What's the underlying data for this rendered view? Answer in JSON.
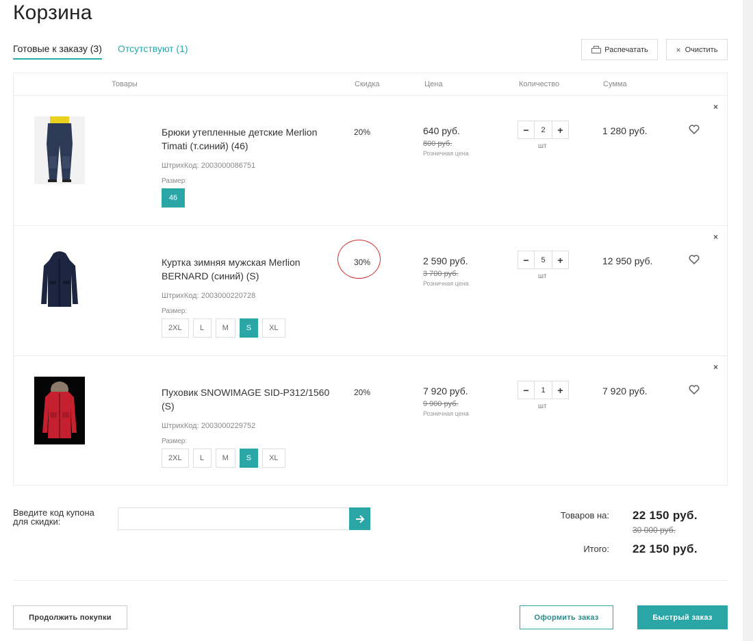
{
  "page": {
    "title": "Корзина"
  },
  "tabs": [
    {
      "label": "Готовые к заказу (3)",
      "active": true
    },
    {
      "label": "Отсутствуют (1)",
      "active": false
    }
  ],
  "toolbar": {
    "print_label": "Распечатать",
    "clear_label": "Очистить"
  },
  "table": {
    "headers": {
      "goods": "Товары",
      "discount": "Скидка",
      "price": "Цена",
      "quantity": "Количество",
      "sum": "Сумма"
    },
    "items": [
      {
        "name": "Брюки утепленные детские Merlion Timati (т.синий) (46)",
        "barcode": "ШтрихКод: 2003000086751",
        "size_label": "Размер:",
        "sizes": [
          {
            "label": "46",
            "selected": true
          }
        ],
        "discount": "20%",
        "price": "640 руб.",
        "old_price": "800 руб.",
        "price_type": "Розничная цена",
        "quantity": "2",
        "unit": "шт",
        "sum": "1 280 руб."
      },
      {
        "name": "Куртка зимняя мужская Merlion BERNARD (синий) (S)",
        "barcode": "ШтрихКод: 2003000220728",
        "size_label": "Размер:",
        "sizes": [
          {
            "label": "2XL",
            "selected": false
          },
          {
            "label": "L",
            "selected": false
          },
          {
            "label": "M",
            "selected": false
          },
          {
            "label": "S",
            "selected": true
          },
          {
            "label": "XL",
            "selected": false
          }
        ],
        "discount": "30%",
        "price": "2 590 руб.",
        "old_price": "3 700 руб.",
        "price_type": "Розничная цена",
        "quantity": "5",
        "unit": "шт",
        "sum": "12 950 руб."
      },
      {
        "name": "Пуховик SNOWIMAGE SID-P312/1560 (S)",
        "barcode": "ШтрихКод: 2003000229752",
        "size_label": "Размер:",
        "sizes": [
          {
            "label": "2XL",
            "selected": false
          },
          {
            "label": "L",
            "selected": false
          },
          {
            "label": "M",
            "selected": false
          },
          {
            "label": "S",
            "selected": true
          },
          {
            "label": "XL",
            "selected": false
          }
        ],
        "discount": "20%",
        "price": "7 920 руб.",
        "old_price": "9 900 руб.",
        "price_type": "Розничная цена",
        "quantity": "1",
        "unit": "шт",
        "sum": "7 920 руб."
      }
    ]
  },
  "coupon": {
    "label": "Введите код купона для скидки:",
    "value": ""
  },
  "totals": {
    "goods_label": "Товаров на:",
    "goods_value": "22 150 руб.",
    "goods_old": "30 000 руб.",
    "total_label": "Итого:",
    "total_value": "22 150 руб."
  },
  "actions": {
    "continue_label": "Продолжить покупки",
    "order_label": "Оформить заказ",
    "fast_label": "Быстрый заказ"
  },
  "colors": {
    "accent": "#2aa6a6",
    "annotation": "#d22a2a"
  }
}
